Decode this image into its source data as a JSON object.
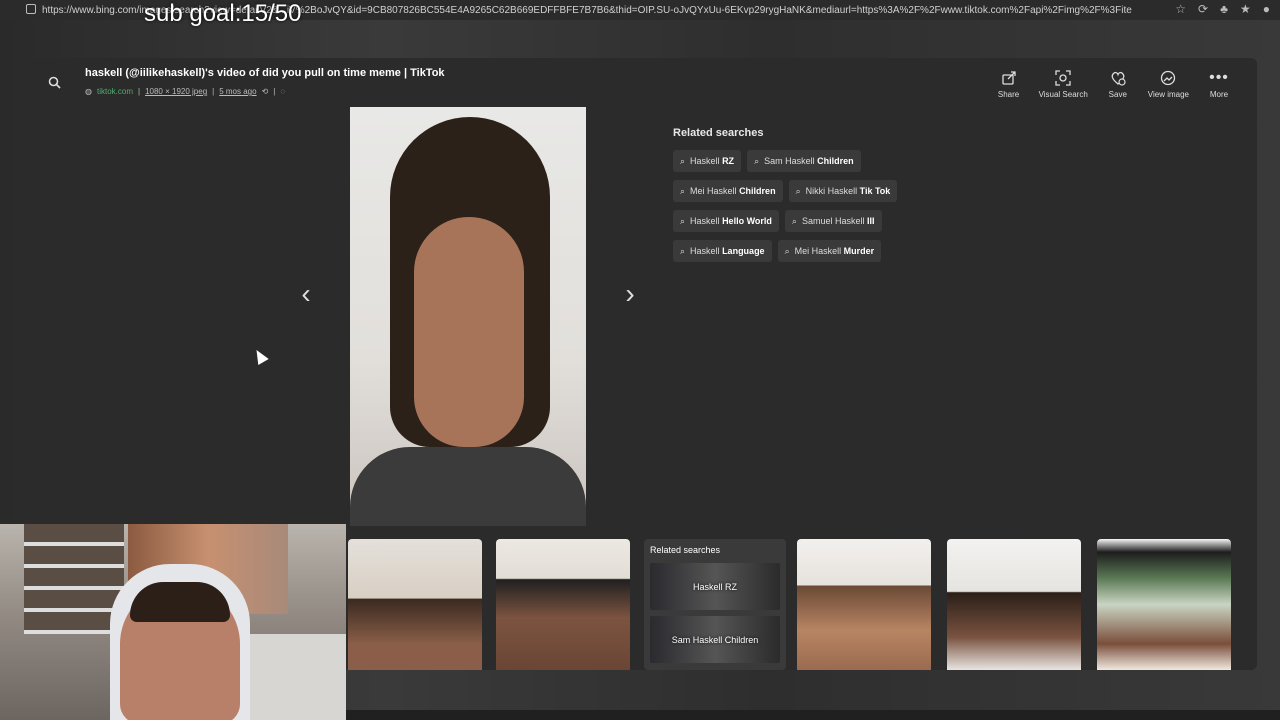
{
  "browser": {
    "url": "https://www.bing.com/images/search?view=detailV2&...iV%2BoJvQY&id=9CB807826BC554E4A9265C62B669EDFFBFE7B7B6&thid=OIP.SU-oJvQYxUu-6EKvp29rygHaNK&mediaurl=https%3A%2F%2Fwww.tiktok.com%2Fapi%2Fimg%2F%3Fitemi..."
  },
  "stream_overlay": {
    "text": "sub goal:15/50"
  },
  "viewer": {
    "title": "haskell (@iilikehaskell)'s video of did you pull on time meme | TikTok",
    "site": "tiktok.com",
    "dimensions": "1080 × 1920 jpeg",
    "age": "5 mos ago",
    "separator": "|",
    "actions": [
      {
        "label": "Share",
        "icon": "share-icon"
      },
      {
        "label": "Visual Search",
        "icon": "visual-search-icon"
      },
      {
        "label": "Save",
        "icon": "save-icon"
      },
      {
        "label": "View image",
        "icon": "view-image-icon"
      },
      {
        "label": "More",
        "icon": "more-icon"
      }
    ]
  },
  "related": {
    "title": "Related searches",
    "chips": [
      {
        "plain": "Haskell ",
        "bold": "RZ"
      },
      {
        "plain": "Sam Haskell ",
        "bold": "Children"
      },
      {
        "plain": "Mei Haskell ",
        "bold": "Children"
      },
      {
        "plain": "Nikki Haskell ",
        "bold": "Tik Tok"
      },
      {
        "plain": "Haskell ",
        "bold": "Hello World"
      },
      {
        "plain": "Samuel Haskell ",
        "bold": "III"
      },
      {
        "plain": "Haskell ",
        "bold": "Language"
      },
      {
        "plain": "Mei Haskell ",
        "bold": "Murder"
      }
    ]
  },
  "strip": {
    "related_card": {
      "title": "Related searches",
      "items": [
        "Haskell RZ",
        "Sam Haskell Children"
      ]
    }
  }
}
